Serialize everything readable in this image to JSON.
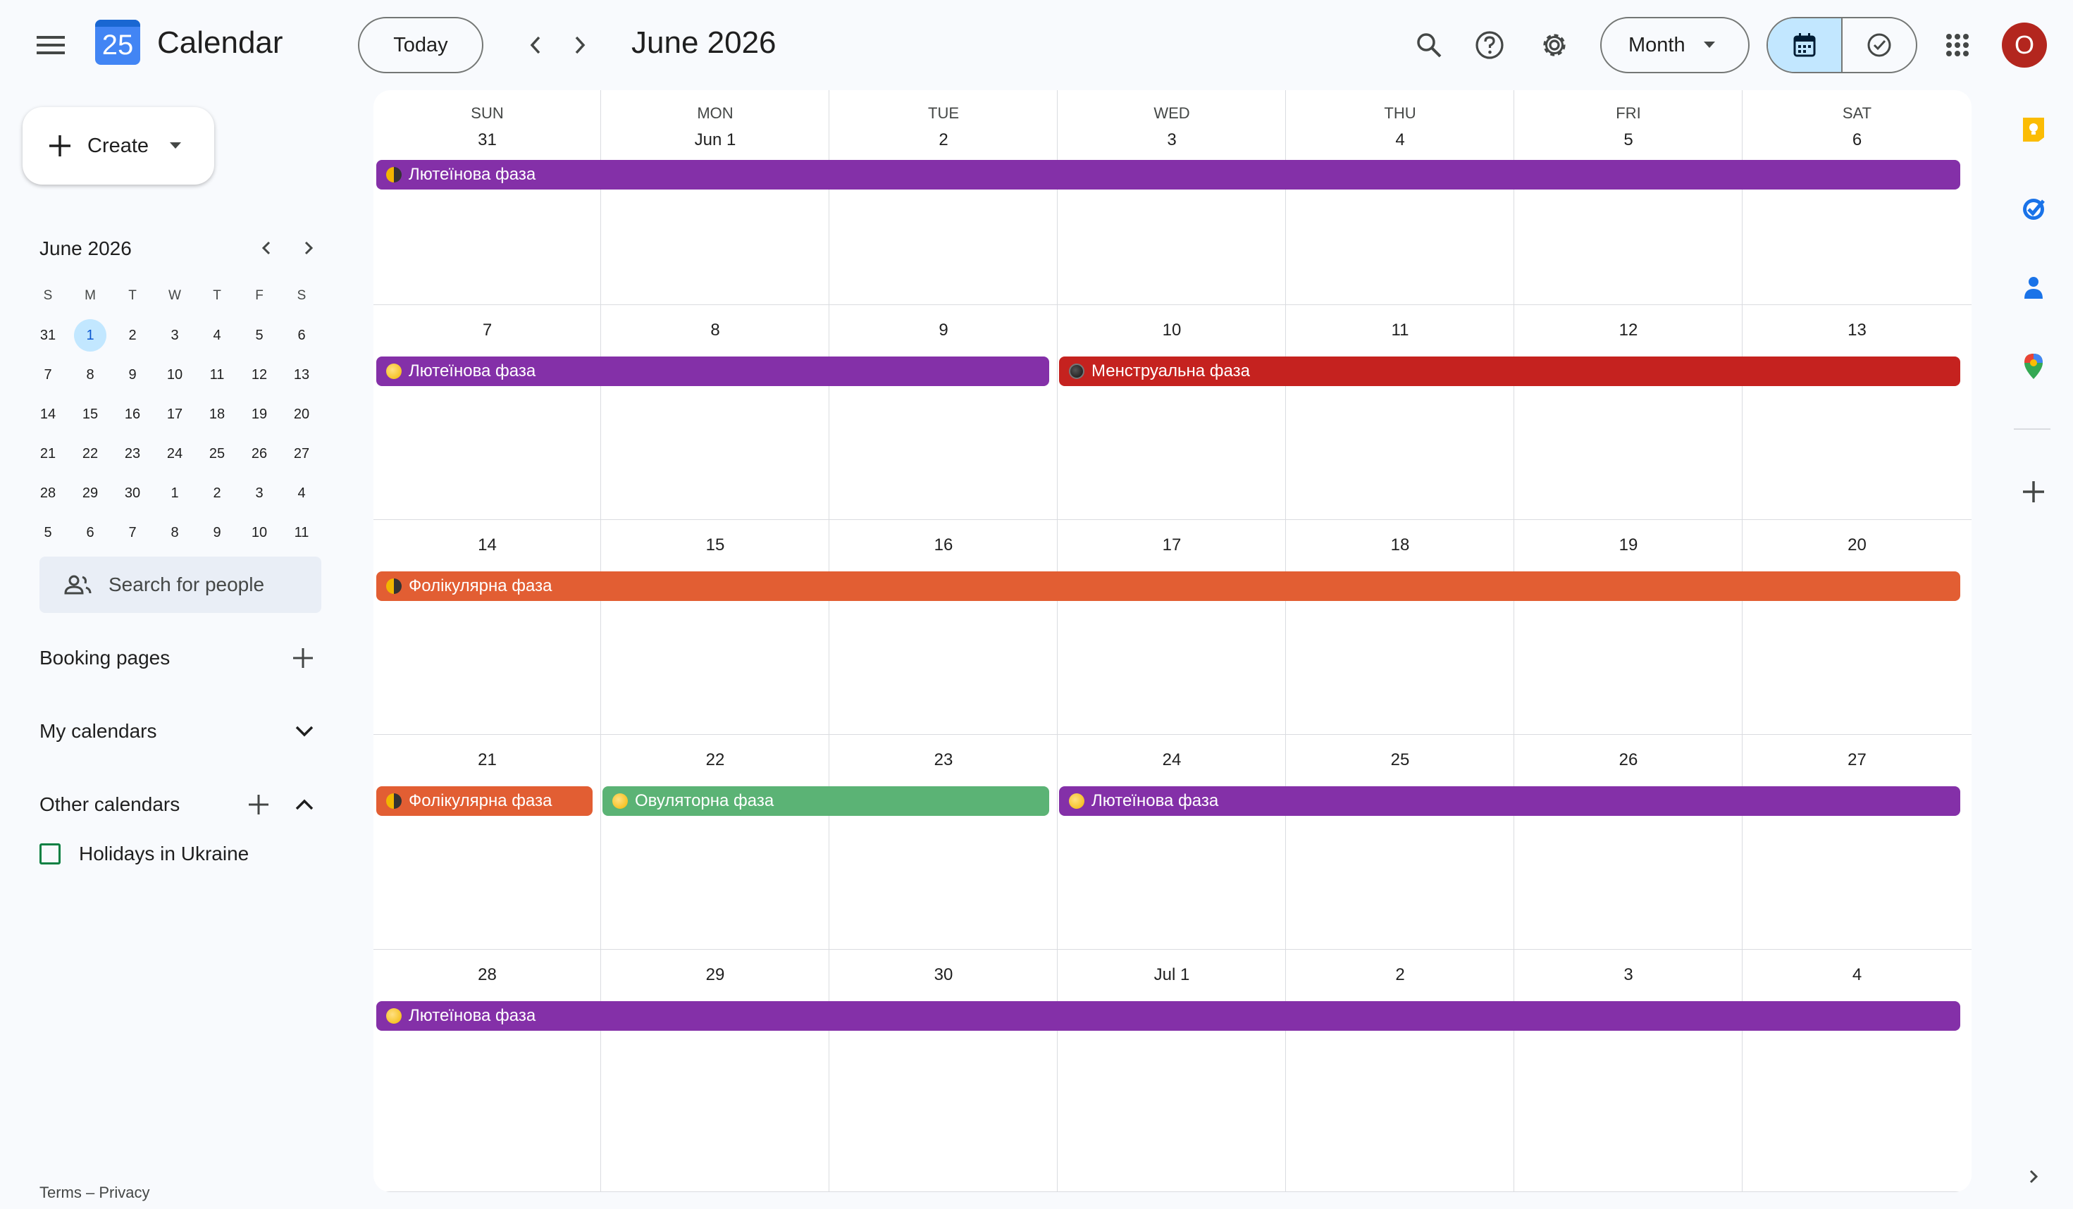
{
  "header": {
    "app_title": "Calendar",
    "logo_day": "25",
    "today_label": "Today",
    "current_period": "June 2026",
    "view_select": "Month",
    "avatar_letter": "O"
  },
  "sidebar": {
    "create_label": "Create",
    "mini_calendar": {
      "title": "June 2026",
      "dow": [
        "S",
        "M",
        "T",
        "W",
        "T",
        "F",
        "S"
      ],
      "weeks": [
        [
          "31",
          "1",
          "2",
          "3",
          "4",
          "5",
          "6"
        ],
        [
          "7",
          "8",
          "9",
          "10",
          "11",
          "12",
          "13"
        ],
        [
          "14",
          "15",
          "16",
          "17",
          "18",
          "19",
          "20"
        ],
        [
          "21",
          "22",
          "23",
          "24",
          "25",
          "26",
          "27"
        ],
        [
          "28",
          "29",
          "30",
          "1",
          "2",
          "3",
          "4"
        ],
        [
          "5",
          "6",
          "7",
          "8",
          "9",
          "10",
          "11"
        ]
      ],
      "today": "1"
    },
    "search_people_placeholder": "Search for people",
    "booking_pages": "Booking pages",
    "my_calendars": "My calendars",
    "other_calendars": "Other calendars",
    "other_calendar_items": [
      "Holidays in Ukraine"
    ],
    "footer": "Terms – Privacy"
  },
  "calendar": {
    "dow": [
      "SUN",
      "MON",
      "TUE",
      "WED",
      "THU",
      "FRI",
      "SAT"
    ],
    "weeks": [
      [
        "31",
        "Jun 1",
        "2",
        "3",
        "4",
        "5",
        "6"
      ],
      [
        "7",
        "8",
        "9",
        "10",
        "11",
        "12",
        "13"
      ],
      [
        "14",
        "15",
        "16",
        "17",
        "18",
        "19",
        "20"
      ],
      [
        "21",
        "22",
        "23",
        "24",
        "25",
        "26",
        "27"
      ],
      [
        "28",
        "29",
        "30",
        "Jul 1",
        "2",
        "3",
        "4"
      ]
    ],
    "events": [
      {
        "week": 0,
        "start": 0,
        "end": 6,
        "title": "Лютеїнова фаза",
        "color": "#8430a8",
        "icon": "half",
        "cont": true
      },
      {
        "week": 1,
        "start": 0,
        "end": 2,
        "title": "Лютеїнова фаза",
        "color": "#8430a8",
        "icon": "full"
      },
      {
        "week": 1,
        "start": 3,
        "end": 6,
        "title": "Менструальна фаза",
        "color": "#c5221f",
        "icon": "dark"
      },
      {
        "week": 2,
        "start": 0,
        "end": 6,
        "title": "Фолікулярна фаза",
        "color": "#e25e33",
        "icon": "half"
      },
      {
        "week": 3,
        "start": 0,
        "end": 0,
        "title": "Фолікулярна фаза",
        "color": "#e25e33",
        "icon": "half"
      },
      {
        "week": 3,
        "start": 1,
        "end": 2,
        "title": "Овуляторна фаза",
        "color": "#5bb375",
        "icon": "full"
      },
      {
        "week": 3,
        "start": 3,
        "end": 6,
        "title": "Лютеїнова фаза",
        "color": "#8430a8",
        "icon": "full"
      },
      {
        "week": 4,
        "start": 0,
        "end": 6,
        "title": "Лютеїнова фаза",
        "color": "#8430a8",
        "icon": "full"
      }
    ]
  }
}
